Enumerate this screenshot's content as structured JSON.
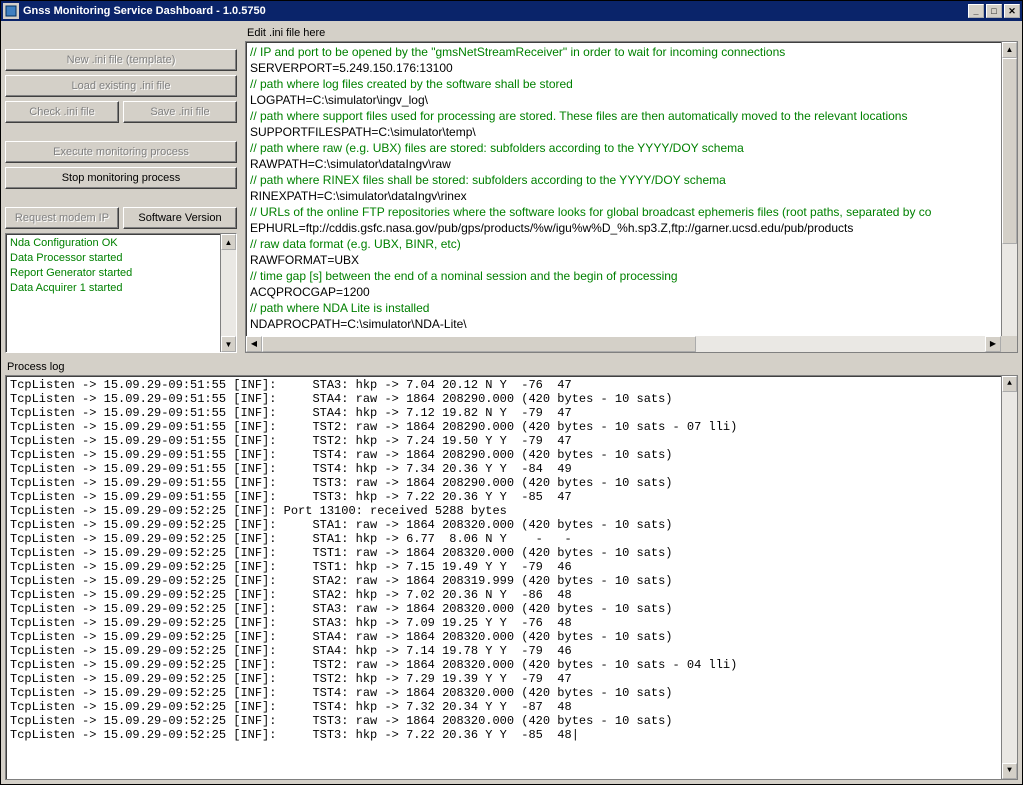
{
  "window": {
    "title": "Gnss Monitoring Service Dashboard - 1.0.5750"
  },
  "buttons": {
    "new_ini": "New .ini file (template)",
    "load_ini": "Load existing .ini file",
    "check_ini": "Check .ini file",
    "save_ini": "Save .ini file",
    "execute": "Execute monitoring process",
    "stop": "Stop monitoring process",
    "modem_ip": "Request modem IP",
    "sw_version": "Software Version"
  },
  "status": {
    "lines": [
      "Nda Configuration OK",
      "Data Processor started",
      "Report Generator started",
      "Data Acquirer 1 started"
    ]
  },
  "editor": {
    "label": "Edit .ini file here",
    "lines": [
      {
        "t": "cmt",
        "v": "// IP and port to be opened by the \"gmsNetStreamReceiver\" in order to wait for incoming connections"
      },
      {
        "t": "txt",
        "v": "SERVERPORT=5.249.150.176:13100"
      },
      {
        "t": "cmt",
        "v": "// path where log files created by the software shall be stored"
      },
      {
        "t": "txt",
        "v": "LOGPATH=C:\\simulator\\ingv_log\\"
      },
      {
        "t": "cmt",
        "v": "// path where support files used for processing are stored. These files are then automatically moved to the relevant locations"
      },
      {
        "t": "txt",
        "v": "SUPPORTFILESPATH=C:\\simulator\\temp\\"
      },
      {
        "t": "cmt",
        "v": "// path where raw (e.g. UBX) files are stored: subfolders according to the YYYY/DOY schema"
      },
      {
        "t": "txt",
        "v": "RAWPATH=C:\\simulator\\dataIngv\\raw"
      },
      {
        "t": "cmt",
        "v": "// path where RINEX files shall be stored: subfolders according to the YYYY/DOY schema"
      },
      {
        "t": "txt",
        "v": "RINEXPATH=C:\\simulator\\dataIngv\\rinex"
      },
      {
        "t": "cmt",
        "v": "// URLs of the online FTP repositories where the software looks for global broadcast ephemeris files (root paths, separated by co"
      },
      {
        "t": "txt",
        "v": "EPHURL=ftp://cddis.gsfc.nasa.gov/pub/gps/products/%w/igu%w%D_%h.sp3.Z,ftp://garner.ucsd.edu/pub/products"
      },
      {
        "t": "cmt",
        "v": "// raw data format (e.g. UBX, BINR, etc)"
      },
      {
        "t": "txt",
        "v": "RAWFORMAT=UBX"
      },
      {
        "t": "cmt",
        "v": "// time gap [s] between the end of a nominal session and the begin of processing"
      },
      {
        "t": "txt",
        "v": "ACQPROCGAP=1200"
      },
      {
        "t": "cmt",
        "v": "// path where NDA Lite is installed"
      },
      {
        "t": "txt",
        "v": "NDAPROCPATH=C:\\simulator\\NDA-Lite\\"
      }
    ]
  },
  "log": {
    "label": "Process log",
    "lines": [
      "TcpListen -> 15.09.29-09:51:55 [INF]:     STA3: hkp -> 7.04 20.12 N Y  -76  47",
      "TcpListen -> 15.09.29-09:51:55 [INF]:     STA4: raw -> 1864 208290.000 (420 bytes - 10 sats)",
      "TcpListen -> 15.09.29-09:51:55 [INF]:     STA4: hkp -> 7.12 19.82 N Y  -79  47",
      "TcpListen -> 15.09.29-09:51:55 [INF]:     TST2: raw -> 1864 208290.000 (420 bytes - 10 sats - 07 lli)",
      "TcpListen -> 15.09.29-09:51:55 [INF]:     TST2: hkp -> 7.24 19.50 Y Y  -79  47",
      "TcpListen -> 15.09.29-09:51:55 [INF]:     TST4: raw -> 1864 208290.000 (420 bytes - 10 sats)",
      "TcpListen -> 15.09.29-09:51:55 [INF]:     TST4: hkp -> 7.34 20.36 Y Y  -84  49",
      "TcpListen -> 15.09.29-09:51:55 [INF]:     TST3: raw -> 1864 208290.000 (420 bytes - 10 sats)",
      "TcpListen -> 15.09.29-09:51:55 [INF]:     TST3: hkp -> 7.22 20.36 Y Y  -85  47",
      "TcpListen -> 15.09.29-09:52:25 [INF]: Port 13100: received 5288 bytes",
      "TcpListen -> 15.09.29-09:52:25 [INF]:     STA1: raw -> 1864 208320.000 (420 bytes - 10 sats)",
      "TcpListen -> 15.09.29-09:52:25 [INF]:     STA1: hkp -> 6.77  8.06 N Y    -   -",
      "TcpListen -> 15.09.29-09:52:25 [INF]:     TST1: raw -> 1864 208320.000 (420 bytes - 10 sats)",
      "TcpListen -> 15.09.29-09:52:25 [INF]:     TST1: hkp -> 7.15 19.49 Y Y  -79  46",
      "TcpListen -> 15.09.29-09:52:25 [INF]:     STA2: raw -> 1864 208319.999 (420 bytes - 10 sats)",
      "TcpListen -> 15.09.29-09:52:25 [INF]:     STA2: hkp -> 7.02 20.36 N Y  -86  48",
      "TcpListen -> 15.09.29-09:52:25 [INF]:     STA3: raw -> 1864 208320.000 (420 bytes - 10 sats)",
      "TcpListen -> 15.09.29-09:52:25 [INF]:     STA3: hkp -> 7.09 19.25 Y Y  -76  48",
      "TcpListen -> 15.09.29-09:52:25 [INF]:     STA4: raw -> 1864 208320.000 (420 bytes - 10 sats)",
      "TcpListen -> 15.09.29-09:52:25 [INF]:     STA4: hkp -> 7.14 19.78 Y Y  -79  46",
      "TcpListen -> 15.09.29-09:52:25 [INF]:     TST2: raw -> 1864 208320.000 (420 bytes - 10 sats - 04 lli)",
      "TcpListen -> 15.09.29-09:52:25 [INF]:     TST2: hkp -> 7.29 19.39 Y Y  -79  47",
      "TcpListen -> 15.09.29-09:52:25 [INF]:     TST4: raw -> 1864 208320.000 (420 bytes - 10 sats)",
      "TcpListen -> 15.09.29-09:52:25 [INF]:     TST4: hkp -> 7.32 20.34 Y Y  -87  48",
      "TcpListen -> 15.09.29-09:52:25 [INF]:     TST3: raw -> 1864 208320.000 (420 bytes - 10 sats)",
      "TcpListen -> 15.09.29-09:52:25 [INF]:     TST3: hkp -> 7.22 20.36 Y Y  -85  48|"
    ]
  }
}
